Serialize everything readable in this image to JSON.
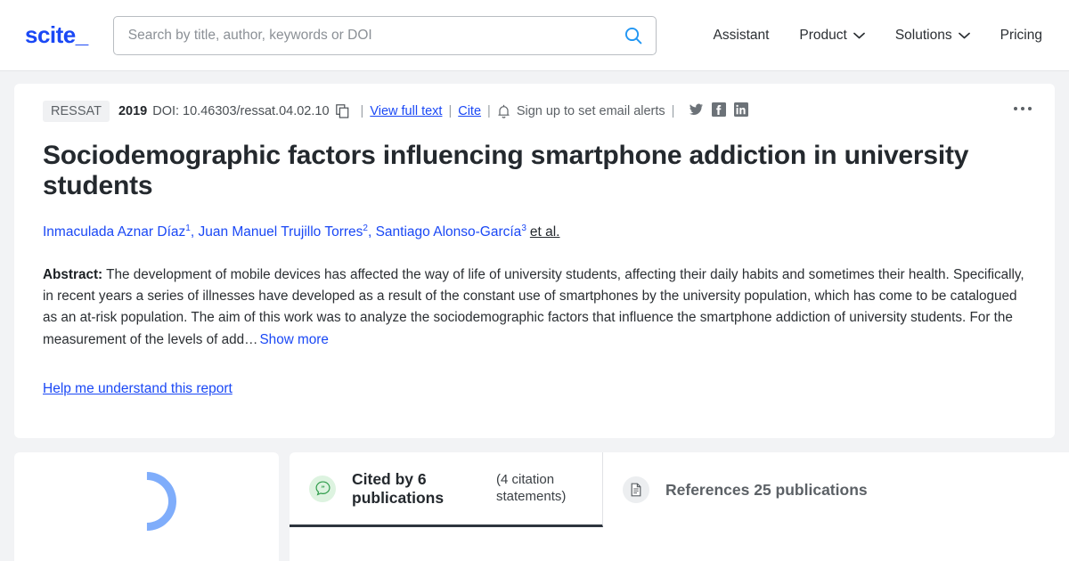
{
  "header": {
    "logo": "scite_",
    "search": {
      "placeholder": "Search by title, author, keywords or DOI",
      "value": "",
      "icon": "search-icon"
    },
    "nav": [
      {
        "label": "Assistant",
        "has_caret": false
      },
      {
        "label": "Product",
        "has_caret": true
      },
      {
        "label": "Solutions",
        "has_caret": true
      },
      {
        "label": "Pricing",
        "has_caret": false
      }
    ]
  },
  "paper": {
    "journal_badge": "RESSAT",
    "year": "2019",
    "doi": "DOI: 10.46303/ressat.04.02.10",
    "copy_icon": "copy-icon",
    "view_full_text": "View full text",
    "cite": "Cite",
    "bell_icon": "bell-icon",
    "email_alerts": "Sign up to set email alerts",
    "separator": "|",
    "socials": [
      "twitter-icon",
      "facebook-icon",
      "linkedin-icon"
    ],
    "overflow_menu": "more-options-icon",
    "title": "Sociodemographic factors influencing smartphone addiction in university students",
    "authors": [
      {
        "name": "Inmaculada Aznar Díaz",
        "sup": "1"
      },
      {
        "name": "Juan Manuel Trujillo Torres",
        "sup": "2"
      },
      {
        "name": "Santiago Alonso-García",
        "sup": "3"
      }
    ],
    "et_al": "et al.",
    "abstract_label": "Abstract:",
    "abstract_text": "The development of mobile devices has affected the way of life of university students, affecting their daily habits and sometimes their health. Specifically, in recent years a series of illnesses have developed as a result of the constant use of smartphones by the university population, which has come to be catalogued as an at-risk population. The aim of this work was to analyze the sociodemographic factors that influence the smartphone addiction of university students. For the measurement of the levels of add…",
    "show_more": "Show more",
    "help_link": "Help me understand this report"
  },
  "bottom": {
    "spinner": "loading-spinner",
    "tabs": [
      {
        "id": "cited-by",
        "icon": "quote-bubble-icon",
        "label": "Cited by 6 publications",
        "sub": "(4 citation statements)",
        "active": true
      },
      {
        "id": "references",
        "icon": "document-icon",
        "label": "References 25 publications",
        "sub": "",
        "active": false
      }
    ]
  },
  "colors": {
    "brand_blue": "#1a48f5",
    "search_icon_blue": "#2196f3",
    "spinner_blue": "#7fadfb",
    "active_tab_underline": "#2e353e",
    "quote_icon_green": "#2e9c4a",
    "page_bg": "#f2f3f5"
  }
}
